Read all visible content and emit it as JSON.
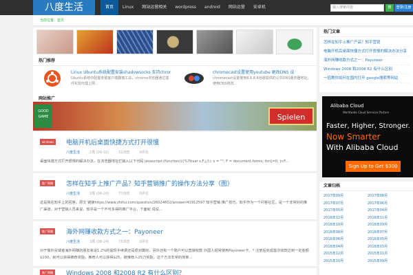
{
  "header": {
    "logo": "八度生活",
    "nav": [
      "首页",
      "Linux",
      "网站运营相关",
      "wordpress",
      "android",
      "网站运营",
      "安卓机"
    ],
    "search_placeholder": "输入搜索内容",
    "search_button": "搜",
    "login_button": "登录/注册"
  },
  "breadcrumb": "当前位置：首页",
  "hot": {
    "title": "热门推荐",
    "items": [
      {
        "title": "Linux Ubuntu系统配置安装shadowsocks 支持chrome",
        "desc": "Ubuntu系统中配置安装客户端翻墙工具，chrome浏览器通过插件实现代理上网..."
      },
      {
        "title": "chromecast设置使用youtube 更改DNS 设",
        "desc": "chromecast设置使用8.8.8.8谷歌提供的公共DNS服务器地址，使用DNS修改..."
      }
    ]
  },
  "ad": {
    "section_title": "网站推广",
    "logo_line1": "GOOD",
    "logo_line2": "GAME",
    "button": "Spielen"
  },
  "posts": [
    {
      "tag": "windows",
      "title": "电脑开机后桌面快捷方式打开很慢",
      "date": "2周 (09-02)",
      "views": "52浏览",
      "comments": "0评论",
      "excerpt": "桌面快捷方式打开很慢的解决办法，在浏览器地址栏输入以下代码 javascript:(function(){%7bvar s,F,j,f,i; s = \"\"; F = document.forms; for(j=0; j<F..."
    },
    {
      "tag": "推广网赚",
      "title": "怎样在知乎上推广产品？知乎营销推广的操作方法分享（图）",
      "date": "3周 (08-24)",
      "views": "77浏览",
      "comments": "0评论",
      "excerpt": "这是我在知乎上的回答，原文 链接https://www.zhihu.com/question/26024602/answer/41912597 知乎营销 推广技巧，知乎作为一个问答社区，是一个非常好的推广渠道，对于营销人员来说，知乎是一个不可多得的推广平台，下面就 说说..."
    },
    {
      "tag": "推广网赚",
      "title": "海外网赚收款方式之一：Payoneer",
      "date": "3周 (08-24)",
      "views": "75浏览",
      "comments": "0评论",
      "excerpt": "对于做外贸或者海外网赚的朋友来说1.2%的提现手续费还是很划算的，另外还有一个账户可以直接收款 外国人经常使用Payoneer卡，* 注册后完成首次收款达到一定金额$100，就可以获得推荐奖励，推荐人可以获得$25，被推荐人25刀奖励，这个方法非常的简单..."
    },
    {
      "tag": "推广网赚",
      "title": "Windows 2008 和2008 R2 有什么区别？",
      "date": "",
      "views": "",
      "comments": "",
      "excerpt": ""
    }
  ],
  "sidebar": {
    "hot_title": "热门文章",
    "hot_links": [
      "怎样在知乎上推广产品？知乎营销",
      "电脑开机后桌面快捷方式打开很慢的解决办法分享",
      "海外网赚收款方式之一：Payoneer",
      "Windows 2008 和2008 R2 有什么区别",
      "一招教你如何在国内打开 google搜索等网站"
    ],
    "alibaba": {
      "logo": "Alibaba Cloud",
      "sub": "Worldwide Cloud Services Partner",
      "line1": "Faster, Higher, Stronger.",
      "line2": "Now Smarter",
      "line3": "With Alibaba Cloud",
      "button": "Sign Up to Get $300"
    },
    "archive_title": "文章归档",
    "archive": [
      "2017年09月",
      "2017年08月",
      "2017年07月",
      "2017年06月",
      "2017年05月",
      "2017年04月",
      "2016年12月",
      "2016年11月",
      "2016年10月",
      "2016年09月",
      "2016年08月",
      "2016年07月",
      "2016年06月",
      "2016年05月",
      "2016年04月",
      "2016年03月",
      "2015年12月",
      "2015年11月",
      "2015年10月",
      "2015年09月"
    ]
  },
  "colors": {
    "accent": "#2a7ac0",
    "topbar": "#2f2f2f",
    "tag": "#d9534f",
    "green": "#3cb34a"
  }
}
